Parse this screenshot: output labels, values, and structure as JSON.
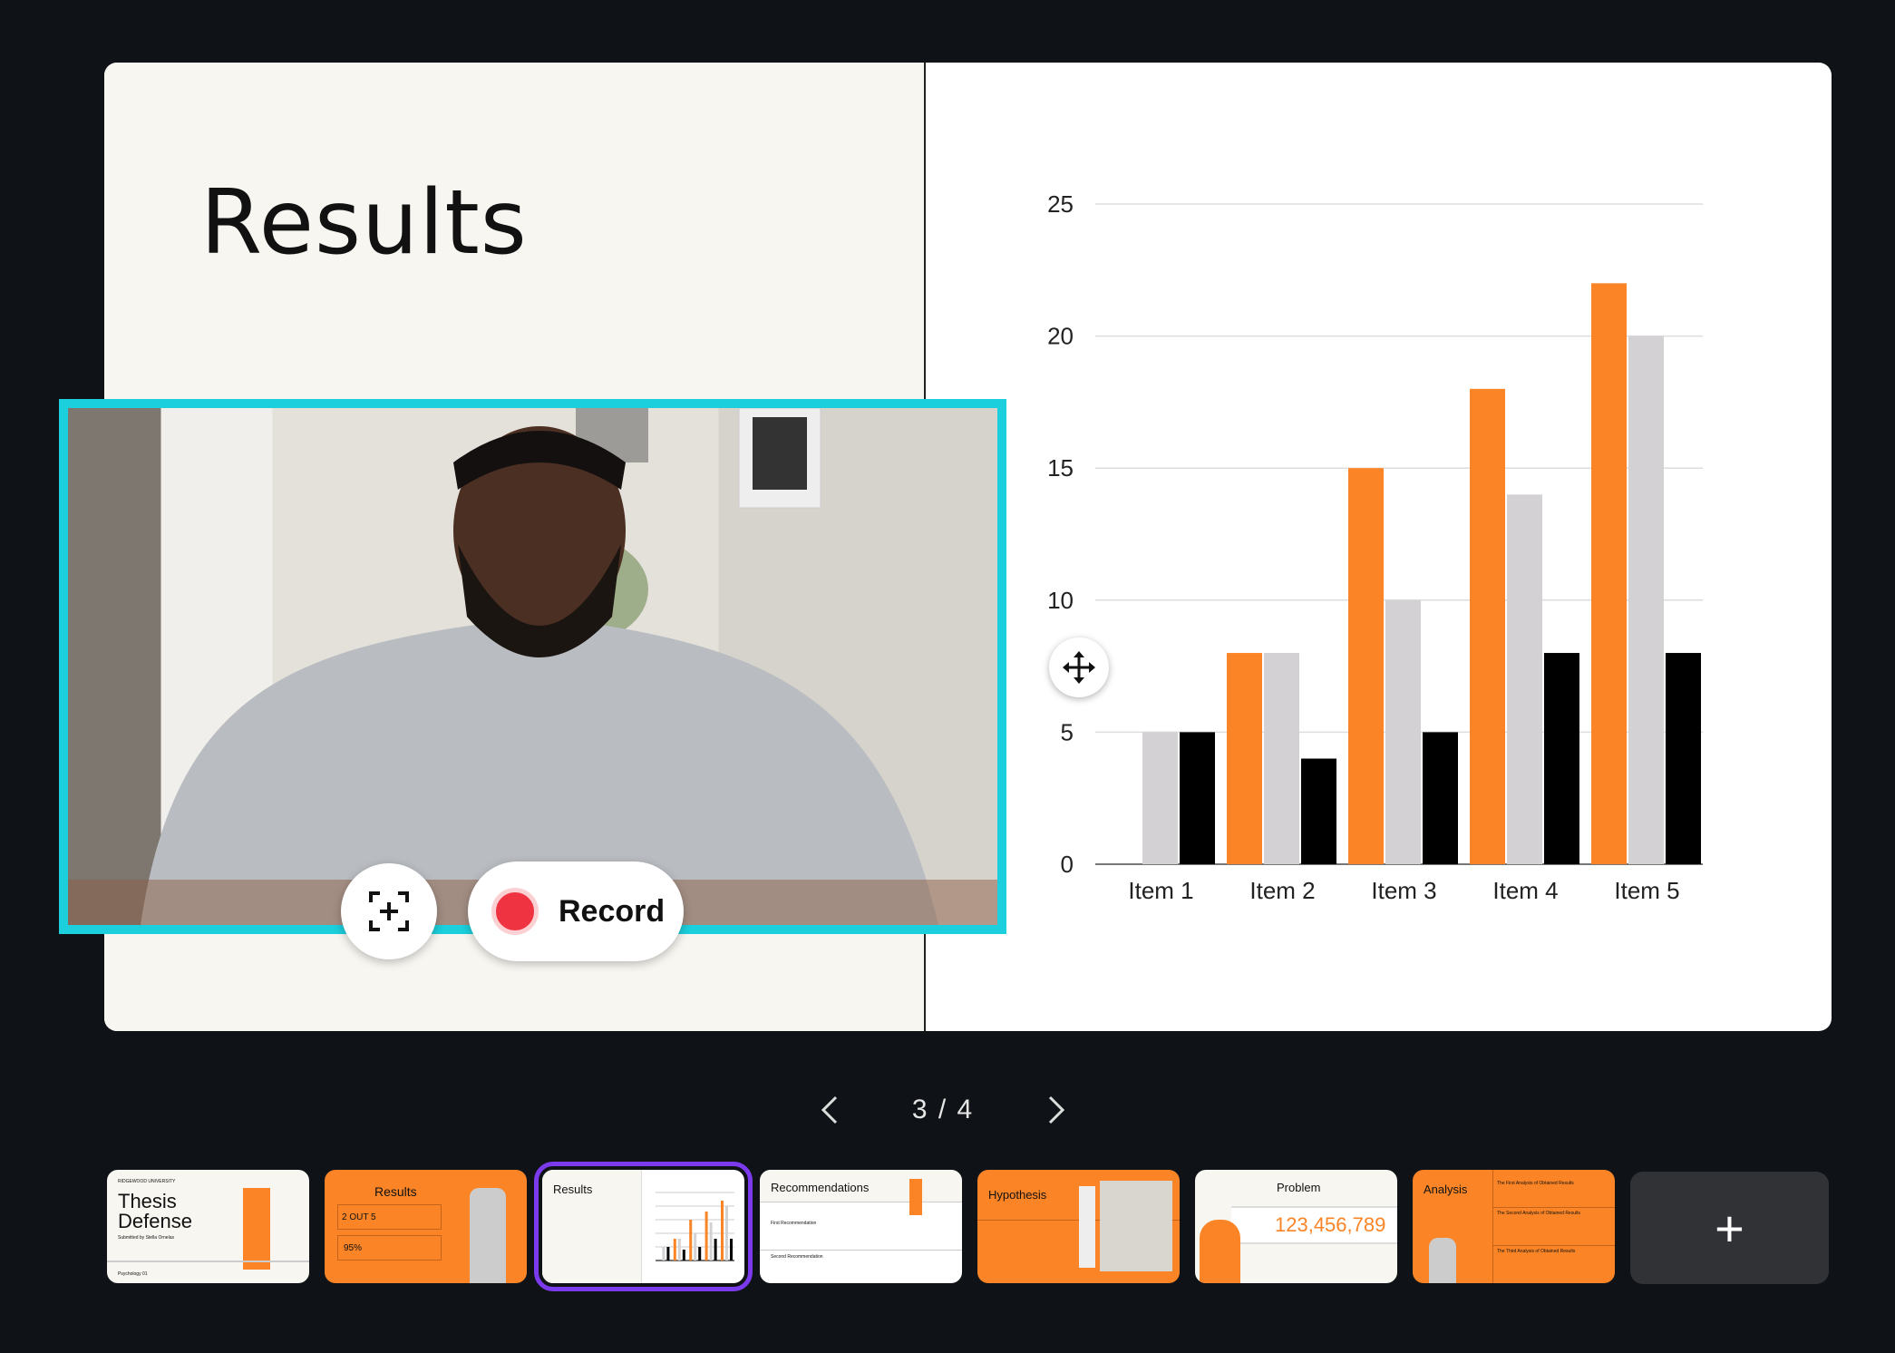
{
  "slide": {
    "title": "Results"
  },
  "chart_data": {
    "type": "bar",
    "categories": [
      "Item 1",
      "Item 2",
      "Item 3",
      "Item 4",
      "Item 5"
    ],
    "series": [
      {
        "values": [
          0,
          8,
          15,
          18,
          22
        ],
        "color": "#fb8526"
      },
      {
        "values": [
          5,
          8,
          10,
          14,
          20
        ],
        "color": "#d3d1d4"
      },
      {
        "values": [
          5,
          4,
          5,
          8,
          8
        ],
        "color": "#000000"
      }
    ],
    "yticks": [
      "0",
      "5",
      "10",
      "15",
      "20",
      "25"
    ],
    "ylim": [
      0,
      25
    ],
    "grid": true
  },
  "video": {
    "record_label": "Record",
    "accent": "#1ccfdc",
    "record_color": "#ef3340"
  },
  "pager": {
    "current": "3 / 4"
  },
  "thumbnails": [
    {
      "title": "Thesis Defense",
      "org": "RIDGEWOOD UNIVERSITY",
      "sub": "Submitted by Stella Ornelas",
      "foot": "Psychology 01"
    },
    {
      "title": "Results",
      "stat1": "2 OUT 5",
      "stat2": "95%"
    },
    {
      "title": "Results"
    },
    {
      "title": "Recommendations",
      "r1": "First Recommendation",
      "r2": "Second Recommendation"
    },
    {
      "title": "Hypothesis"
    },
    {
      "title": "Problem",
      "number": "123,456,789"
    },
    {
      "title": "Analysis",
      "a1": "The First Analysis of Obtained Results",
      "a2": "The Second Analysis of Obtained Results",
      "a3": "The Third Analysis of Obtained Results"
    }
  ],
  "add_label": "+",
  "colors": {
    "orange": "#fb8526",
    "selected": "#7c3aed",
    "background": "#0f1317"
  }
}
